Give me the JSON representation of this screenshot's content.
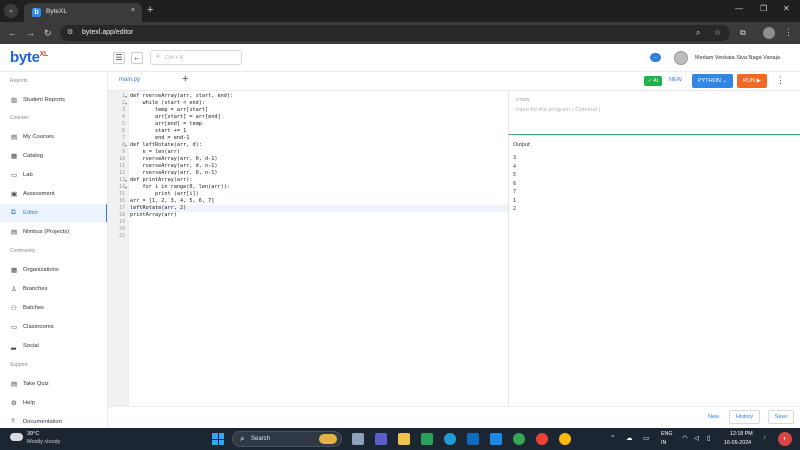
{
  "browser": {
    "tab_title": "ByteXL",
    "tab_favicon": "b",
    "tab_close": "×",
    "new_tab": "+",
    "url": "bytexl.app/editor",
    "win_min": "—",
    "win_max": "❐",
    "win_close": "✕"
  },
  "header": {
    "logo_text": "byte",
    "logo_sup": "XL",
    "search_placeholder": "Ctrl + K",
    "user_name": "Medam Venkata Siva Naga Vanaja"
  },
  "sidebar": {
    "sections": [
      "Reports",
      "Courses",
      "Community",
      "Support"
    ],
    "items": [
      {
        "label": "Student Reports",
        "icon": "chart-icon"
      },
      {
        "label": "My Courses",
        "icon": "book-icon"
      },
      {
        "label": "Catalog",
        "icon": "catalog-icon"
      },
      {
        "label": "Lab",
        "icon": "lab-icon"
      },
      {
        "label": "Assessment",
        "icon": "assessment-icon"
      },
      {
        "label": "Editor",
        "icon": "editor-icon"
      },
      {
        "label": "Nimbus (Projects)",
        "icon": "projects-icon"
      },
      {
        "label": "Organizations",
        "icon": "organizations-icon"
      },
      {
        "label": "Branches",
        "icon": "branches-icon"
      },
      {
        "label": "Batches",
        "icon": "batches-icon"
      },
      {
        "label": "Classrooms",
        "icon": "classrooms-icon"
      },
      {
        "label": "Social",
        "icon": "social-icon"
      },
      {
        "label": "Take Quiz",
        "icon": "quiz-icon"
      },
      {
        "label": "Help",
        "icon": "help-icon"
      },
      {
        "label": "Documentation",
        "icon": "documentation-icon"
      }
    ]
  },
  "editor": {
    "file_name": "main.py",
    "add_file": "+",
    "line_numbers": [
      "1",
      "2",
      "3",
      "4",
      "5",
      "6",
      "7",
      "8",
      "9",
      "10",
      "11",
      "12",
      "13",
      "14",
      "15",
      "16",
      "17",
      "18",
      "19",
      "20",
      "21"
    ],
    "active_line": 17,
    "code": [
      "def rverseArray(arr, start, end):",
      "    while (start < end):",
      "        temp = arr[start]",
      "        arr[start] = arr[end]",
      "        arr[end] = temp",
      "        start += 1",
      "        end = end-1",
      "def leftRotate(arr, d):",
      "    n = len(arr)",
      "    rverseArray(arr, 0, d-1)",
      "    rverseArray(arr, d, n-1)",
      "    rverseArray(arr, 0, n-1)",
      "def printArray(arr):",
      "    for i in range(0, len(arr)):",
      "        print (arr[i])",
      "arr = [1, 2, 3, 4, 5, 6, 7]",
      "leftRotate(arr, 2)",
      "printArray(arr)",
      "",
      "",
      ""
    ]
  },
  "right_panel": {
    "ai_label": "✓ AI",
    "new_label": "NEW",
    "language_label": "PYTHON ⌄",
    "run_label": "RUN ▶",
    "stdin_label": "STDIN",
    "stdin_placeholder": "Input for the program ( Optional )",
    "output_label": "Output:",
    "output_lines": [
      "3",
      "4",
      "5",
      "6",
      "7",
      "1",
      "2"
    ]
  },
  "footer": {
    "new_label": "New",
    "history_label": "History",
    "save_label": "Save"
  },
  "taskbar": {
    "temperature": "39°C",
    "weather": "Mostly cloudy",
    "search_label": "Search",
    "lang_top": "ENG",
    "lang_bottom": "IN",
    "time": "12:18 PM",
    "date": "16-05-2024"
  },
  "colors": {
    "accent": "#2f7fe0",
    "run": "#f26a21",
    "ai": "#21b24b",
    "brand": "#1e63d6"
  }
}
